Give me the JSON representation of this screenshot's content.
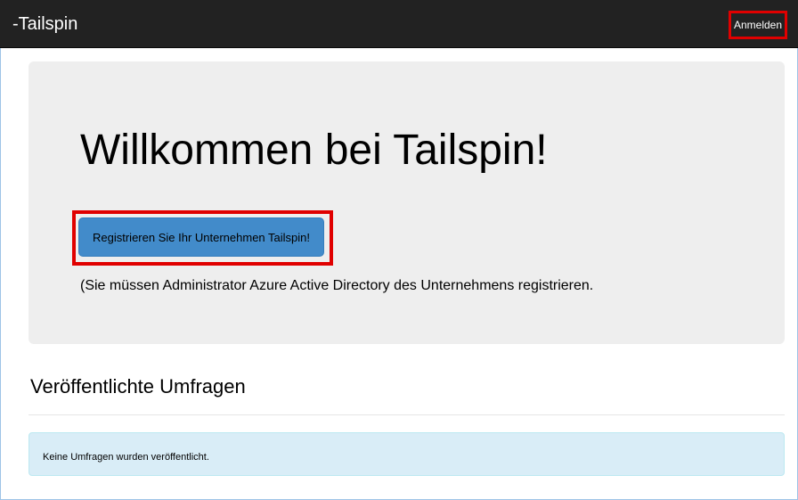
{
  "navbar": {
    "brand": "-Tailspin",
    "signin_label": "Anmelden"
  },
  "jumbotron": {
    "title": "Willkommen bei Tailspin!",
    "register_label": "Registrieren Sie Ihr Unternehmen Tailspin!",
    "note": "(Sie müssen Administrator Azure Active Directory des Unternehmens registrieren."
  },
  "surveys": {
    "heading": "Veröffentlichte Umfragen",
    "empty_message": "Keine Umfragen wurden veröffentlicht."
  },
  "colors": {
    "navbar_bg": "#222222",
    "primary_button": "#428bca",
    "highlight": "#e00000",
    "info_bg": "#d9edf7"
  }
}
